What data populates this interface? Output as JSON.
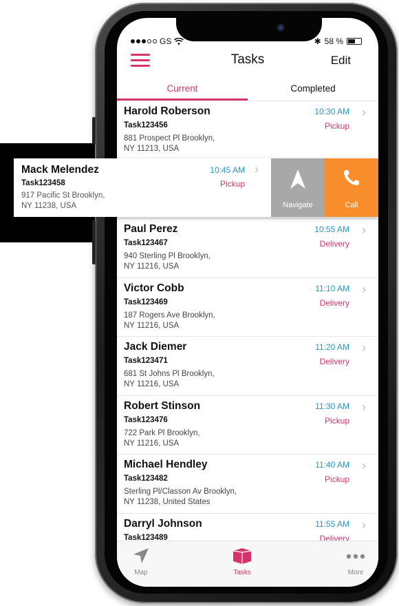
{
  "status_bar": {
    "carrier": "GS",
    "battery": "58 %"
  },
  "header": {
    "title": "Tasks",
    "edit_label": "Edit"
  },
  "tabs": [
    {
      "label": "Current"
    },
    {
      "label": "Completed"
    }
  ],
  "tasks": [
    {
      "name": "Harold Roberson",
      "task_id": "Task123456",
      "address_1": "881 Prospect Pl Brooklyn,",
      "address_2": "NY 11213, USA",
      "time": "10:30 AM",
      "type": "Pickup"
    },
    {
      "name": "Paul Perez",
      "task_id": "Task123467",
      "address_1": "940 Sterling Pl Brooklyn,",
      "address_2": "NY 11216, USA",
      "time": "10:55 AM",
      "type": "Delivery"
    },
    {
      "name": "Victor Cobb",
      "task_id": "Task123469",
      "address_1": "187 Rogers Ave Brooklyn,",
      "address_2": "NY 11216, USA",
      "time": "11:10 AM",
      "type": "Delivery"
    },
    {
      "name": "Jack Diemer",
      "task_id": "Task123471",
      "address_1": "681 St Johns Pl Brooklyn,",
      "address_2": "NY 11216, USA",
      "time": "11:20 AM",
      "type": "Delivery"
    },
    {
      "name": "Robert Stinson",
      "task_id": "Task123476",
      "address_1": "722 Park Pl Brooklyn,",
      "address_2": "NY 11216, USA",
      "time": "11:30 AM",
      "type": "Pickup"
    },
    {
      "name": "Michael Hendley",
      "task_id": "Task123482",
      "address_1": "Sterling Pl/Classon Av Brooklyn,",
      "address_2": "NY 11238, United States",
      "time": "11:40 AM",
      "type": "Pickup"
    },
    {
      "name": "Darryl Johnson",
      "task_id": "Task123489",
      "address_1": "",
      "address_2": "",
      "time": "11:55 AM",
      "type": "Delivery"
    }
  ],
  "swiped_task": {
    "name": "Mack Melendez",
    "task_id": "Task123458",
    "address_1": "917 Pacific St Brooklyn,",
    "address_2": "NY 11238, USA",
    "time": "10:45 AM",
    "type": "Pickup",
    "navigate_label": "Navigate",
    "call_label": "Call"
  },
  "tab_bar": [
    {
      "label": "Map",
      "icon": "navigation-arrow-icon"
    },
    {
      "label": "Tasks",
      "icon": "cube-icon"
    },
    {
      "label": "More",
      "icon": "more-dots-icon"
    }
  ],
  "colors": {
    "accent": "#d6336c",
    "time": "#1e96c8",
    "navigate": "#a8a8a8",
    "call": "#f78d2b"
  }
}
